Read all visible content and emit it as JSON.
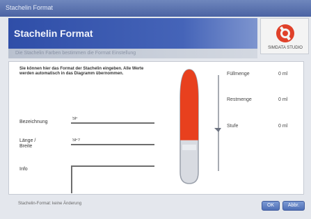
{
  "window": {
    "title": "Stachelin Format"
  },
  "header": {
    "title": "Stachelin Format"
  },
  "logo": {
    "caption": "SIMDATA STUDIO"
  },
  "subtitle": "Die Stachelin Farben bestimmen die Format Einstellung",
  "instructions": "Sie können hier das Format der Stachelin eingeben. Alle Werte werden automatisch in das Diagramm übernommen.",
  "form": {
    "name_label": "Bezeichnung",
    "name_value": "SF",
    "length_label": "Länge / Breite",
    "length_value": "SF?",
    "notes_label": "Info",
    "notes_value": ""
  },
  "gauge": {
    "fill_level": 0.62,
    "fill_color": "#e8401e"
  },
  "readings": [
    {
      "label": "Füllmenge",
      "value": "0 ml"
    },
    {
      "label": "Restmenge",
      "value": "0 ml"
    },
    {
      "label": "Stufe",
      "value": "0 ml"
    }
  ],
  "status": "Stachelin-Format: keine Änderung",
  "buttons": {
    "ok": "OK",
    "cancel": "Abbr."
  }
}
